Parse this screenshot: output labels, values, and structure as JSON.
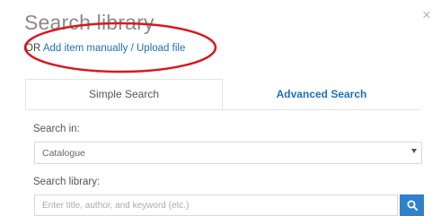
{
  "dialog": {
    "title": "Search library",
    "close_label": "×",
    "or_prefix": "OR ",
    "manual_link": "Add item manually / Upload file"
  },
  "tabs": [
    {
      "label": "Simple Search",
      "active": true
    },
    {
      "label": "Advanced Search",
      "active": false
    }
  ],
  "search_in": {
    "label": "Search in:",
    "selected": "Catalogue"
  },
  "search_library": {
    "label": "Search library:",
    "placeholder": "Enter title, author, and keyword (etc.)",
    "value": ""
  },
  "icons": {
    "close": "close-icon",
    "dropdown": "chevron-down-icon",
    "search": "search-icon"
  },
  "colors": {
    "accent": "#2f82c9",
    "link": "#1f70b8",
    "annotation": "#d71920"
  }
}
